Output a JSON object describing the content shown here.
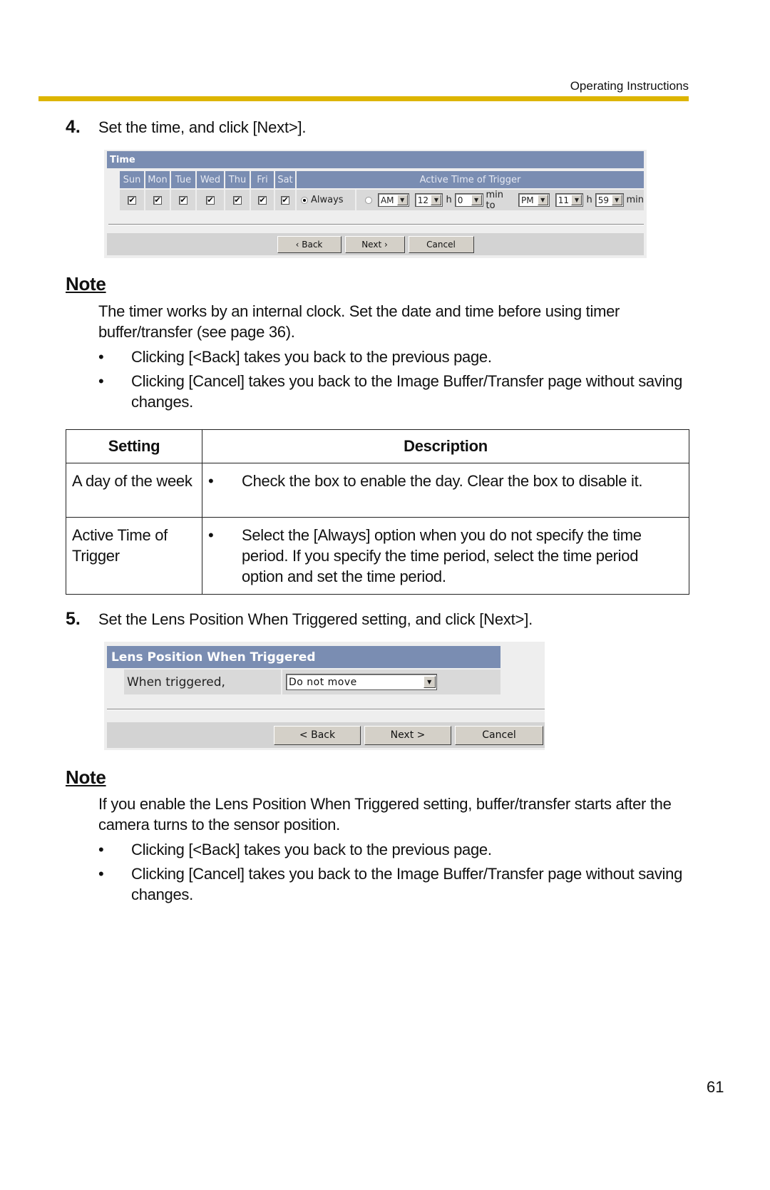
{
  "header": {
    "section_label": "Operating Instructions",
    "rule_color": "#ddb500"
  },
  "steps": [
    {
      "number": "4.",
      "text": "Set the time, and click [Next>]."
    },
    {
      "number": "5.",
      "text": "Set the Lens Position When Triggered setting, and click [Next>]."
    }
  ],
  "time_panel": {
    "title": "Time",
    "days": [
      {
        "label": "Sun",
        "checked": true
      },
      {
        "label": "Mon",
        "checked": true
      },
      {
        "label": "Tue",
        "checked": true
      },
      {
        "label": "Wed",
        "checked": true
      },
      {
        "label": "Thu",
        "checked": true
      },
      {
        "label": "Fri",
        "checked": true
      },
      {
        "label": "Sat",
        "checked": true
      }
    ],
    "trigger_header": "Active Time of Trigger",
    "always_label": "Always",
    "always_selected": true,
    "range_selected": false,
    "start_ampm": "AM",
    "start_hour": "12",
    "hour_unit": "h",
    "start_min": "0",
    "min_to_label": "min to",
    "end_ampm": "PM",
    "end_hour": "11",
    "end_min": "59",
    "min_unit": "min",
    "buttons": {
      "back": "‹ Back",
      "next": "Next ›",
      "cancel": "Cancel"
    },
    "header_color": "#7a8db2"
  },
  "note1": {
    "title": "Note",
    "paragraph": "The timer works by an internal clock. Set the date and time before using timer buffer/transfer (see page 36).",
    "bullets": [
      "Clicking [<Back] takes you back to the previous page.",
      "Clicking [Cancel] takes you back to the Image Buffer/Transfer page without saving changes."
    ]
  },
  "settings_table": {
    "headers": [
      "Setting",
      "Description"
    ],
    "rows": [
      {
        "setting": "A day of the week",
        "description": "Check the box to enable the day. Clear the box to disable it."
      },
      {
        "setting": "Active Time of Trigger",
        "description": "Select the [Always] option when you do not specify the time period. If you specify the time period, select the time period option and set the time period."
      }
    ]
  },
  "lens_panel": {
    "title": "Lens Position When Triggered",
    "field_label": "When triggered,",
    "selected_value": "Do not move",
    "buttons": {
      "back": "< Back",
      "next": "Next >",
      "cancel": "Cancel"
    }
  },
  "note2": {
    "title": "Note",
    "paragraph": "If you enable the Lens Position When Triggered setting, buffer/transfer starts after the camera turns to the sensor position.",
    "bullets": [
      "Clicking [<Back] takes you back to the previous page.",
      "Clicking [Cancel] takes you back to the Image Buffer/Transfer page without saving changes."
    ]
  },
  "page_number": "61",
  "icons": {
    "checkbox_checked": "✔",
    "dropdown_arrow": "▼",
    "bullet": "•"
  }
}
